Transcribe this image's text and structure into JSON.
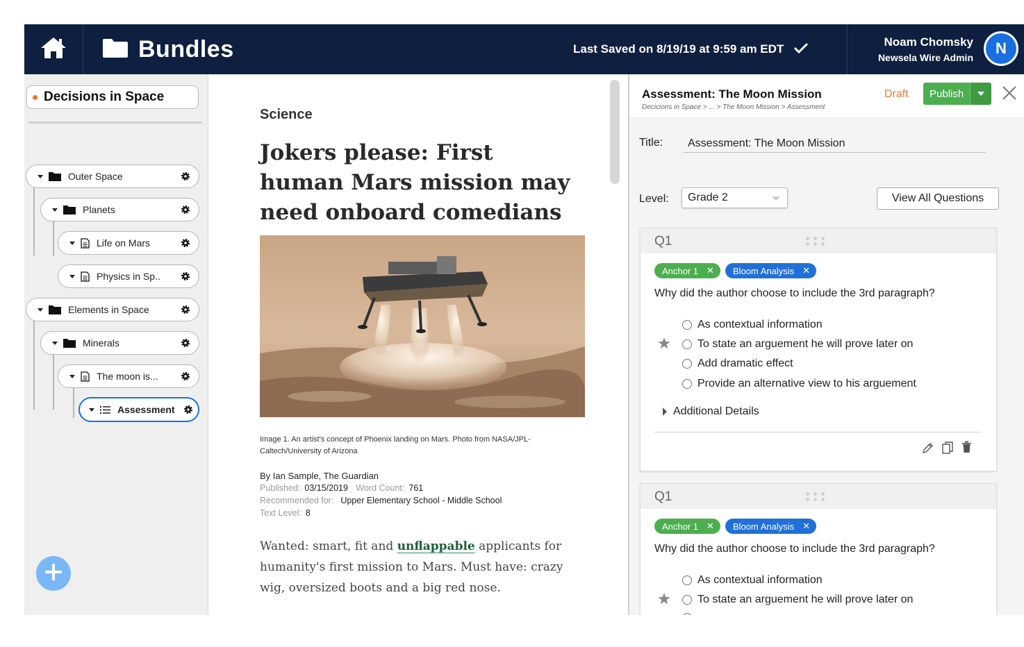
{
  "header": {
    "app_title": "Bundles",
    "last_saved": "Last Saved on 8/19/19 at 9:59 am EDT",
    "user_name": "Noam Chomsky",
    "user_role": "Newsela Wire Admin",
    "avatar_initial": "N"
  },
  "sidebar": {
    "bundle_title": "Decisions in Space",
    "tree": [
      {
        "label": "Outer Space",
        "icon": "folder-icon"
      },
      {
        "label": "Planets",
        "icon": "folder-icon"
      },
      {
        "label": "Life on Mars",
        "icon": "document-icon"
      },
      {
        "label": "Physics in Sp..",
        "icon": "document-icon"
      },
      {
        "label": "Elements in Space",
        "icon": "folder-icon"
      },
      {
        "label": "Minerals",
        "icon": "folder-icon"
      },
      {
        "label": "The moon is...",
        "icon": "document-icon"
      },
      {
        "label": "Assessment",
        "icon": "list-icon",
        "active": true
      }
    ]
  },
  "article": {
    "subject": "Science",
    "headline": "Jokers please: First human Mars mission may need onboard comedians",
    "caption": "Image 1. An artist's concept of Phoenix landing on Mars. Photo from NASA/JPL-Caltech/University of Arizona",
    "byline": "By Ian Sample, The Guardian",
    "published_label": "Published:",
    "published": "03/15/2019",
    "word_count_label": "Word Count:",
    "word_count": "761",
    "recommended_label": "Recommended for:",
    "recommended": "Upper Elementary School - Middle School",
    "text_level_label": "Text Level:",
    "text_level": "8",
    "body_before": "Wanted: smart, fit and ",
    "body_vocab": "unflappable",
    "body_after": " applicants for humanity's first mission to Mars. Must have: crazy wig, oversized boots and a big red nose."
  },
  "panel": {
    "title": "Assessment: The Moon Mission",
    "breadcrumb": "Decicions in Space > ... > The Moon Mission > Assessment",
    "status": "Draft",
    "publish_label": "Publish",
    "title_label": "Title:",
    "title_value": "Assessment: The Moon Mission",
    "level_label": "Level:",
    "level_value": "Grade 2",
    "view_all_label": "View All Questions",
    "questions": [
      {
        "number": "Q1",
        "tags": [
          "Anchor 1",
          "Bloom Analysis"
        ],
        "text": "Why did the author choose to include the 3rd paragraph?",
        "options": [
          "As contextual information",
          "To state an arguement he will prove later on",
          "Add dramatic effect",
          "Provide an alternative view to his arguement"
        ],
        "additional_details": "Additional Details"
      },
      {
        "number": "Q1",
        "tags": [
          "Anchor 1",
          "Bloom Analysis"
        ],
        "text": "Why did the author choose to include the 3rd paragraph?",
        "options": [
          "As contextual information",
          "To state an arguement he will prove later on"
        ]
      }
    ]
  },
  "colors": {
    "navy": "#0e1f3f",
    "accent_blue": "#1a6fe0",
    "green": "#4cae4f",
    "orange": "#e8792e"
  }
}
